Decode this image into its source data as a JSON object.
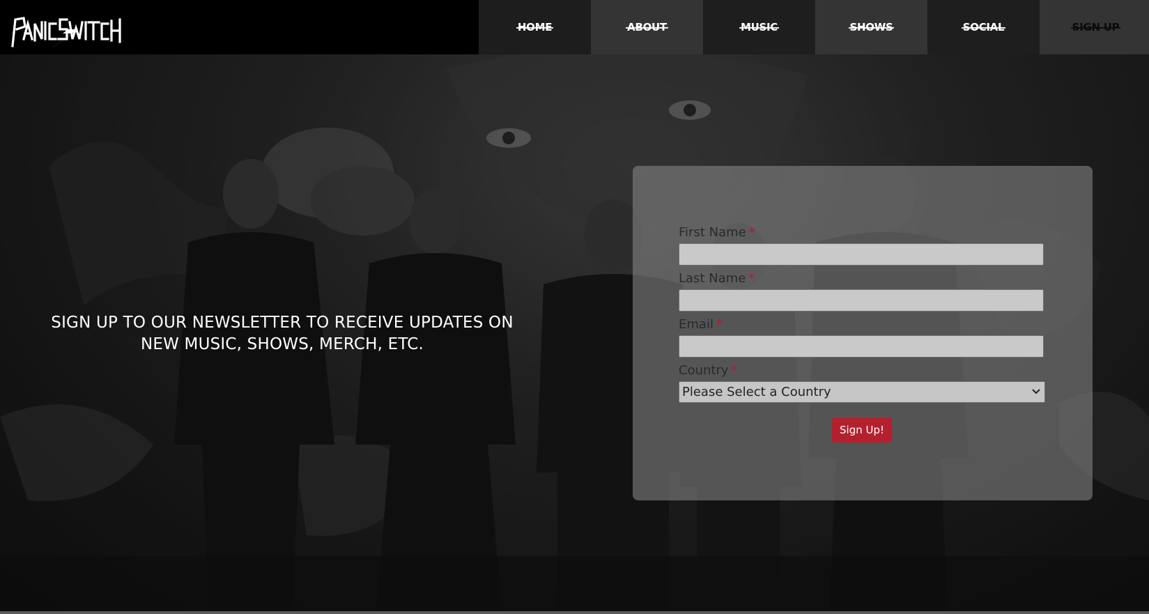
{
  "brand": {
    "logo_text": "PanicSwitch"
  },
  "nav": {
    "items": [
      {
        "label": "HOME"
      },
      {
        "label": "ABOUT"
      },
      {
        "label": "MUSIC"
      },
      {
        "label": "SHOWS"
      },
      {
        "label": "SOCIAL"
      },
      {
        "label": "SIGN UP"
      }
    ]
  },
  "hero": {
    "tagline": "SIGN UP TO OUR NEWSLETTER TO RECEIVE UPDATES ON NEW MUSIC, SHOWS, MERCH, ETC."
  },
  "form": {
    "fields": [
      {
        "label": "First Name",
        "required_mark": "*",
        "value": ""
      },
      {
        "label": "Last Name",
        "required_mark": "*",
        "value": ""
      },
      {
        "label": "Email",
        "required_mark": "*",
        "value": ""
      }
    ],
    "country": {
      "label": "Country",
      "required_mark": "*",
      "selected": "Please Select a Country"
    },
    "submit_label": "Sign Up!"
  },
  "colors": {
    "accent": "#b3212f",
    "required": "#c0142b",
    "header_bg": "#000000"
  }
}
